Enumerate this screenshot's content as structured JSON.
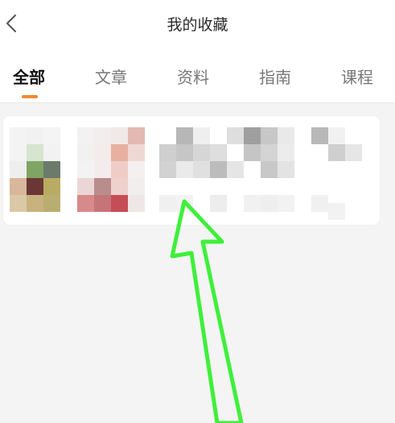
{
  "header": {
    "title": "我的收藏",
    "back_icon": "chevron-left-icon"
  },
  "tabs": [
    {
      "label": "全部",
      "active": true
    },
    {
      "label": "文章",
      "active": false
    },
    {
      "label": "资料",
      "active": false
    },
    {
      "label": "指南",
      "active": false
    },
    {
      "label": "课程",
      "active": false
    }
  ],
  "colors": {
    "accent": "#f08a2c",
    "annotation_arrow": "#3ef03a",
    "background": "#f4f4f4"
  },
  "favorites": [
    {
      "thumbnail_icon": "pixelated-thumbnail-icon",
      "title_icon": "pixelated-text-icon"
    }
  ],
  "annotation": {
    "arrow_icon": "green-arrow-up-icon"
  }
}
